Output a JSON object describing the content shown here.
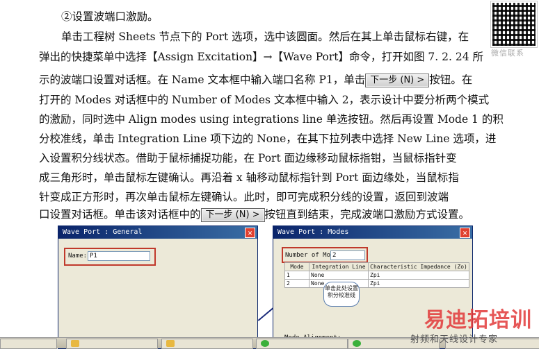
{
  "qr": {
    "label": "微信联系"
  },
  "lines": [
    "②设置波端口激励。",
    "单击工程树 Sheets 节点下的 Port 选项，选中该圆面。然后在其上单击鼠标右键，在",
    "弹出的快捷菜单中选择【Assign Excitation】→【Wave Port】命令，打开如图 7. 2. 24 所",
    "示的波端口设置对话框。在 Name 文本框中输入端口名称 P1，单击",
    "按钮。在",
    "打开的 Modes 对话框中的 Number of Modes 文本框中输入 2，表示设计中要分析两个模式",
    "的激励，同时选中 Align modes using integrations line 单选按钮。然后再设置 Mode 1 的积",
    "分校准线，单击 Integration Line 项下边的 None，在其下拉列表中选择 New Line 选项，进",
    "入设置积分线状态。借助于鼠标捕捉功能，在 Port 面边缘移动鼠标指钳，当鼠标指针变",
    "成三角形时，单击鼠标左键确认。再沿着 x 轴移动鼠标指针到 Port 面边缘处，当鼠标指",
    "针变成正方形时，再次单击鼠标左键确认。此时，即可完成积分线的设置，返回到波端",
    "口设置对话框。单击该对话框中的",
    "按钮直到结束，完成波端口激励方式设置。"
  ],
  "next_button": "下一步 (N) >",
  "dialog_general": {
    "title": "Wave Port : General",
    "name_label": "Name:",
    "name_value": "P1"
  },
  "dialog_modes": {
    "title": "Wave Port : Modes",
    "num_label": "Number of Modes:",
    "num_value": "2",
    "columns": [
      "Mode",
      "Integration Line",
      "Characteristic Impedance (Zo)"
    ],
    "rows": [
      [
        "1",
        "None",
        "Zpi"
      ],
      [
        "2",
        "None",
        "Zpi"
      ]
    ],
    "callout": "单击此处设置积分校准线",
    "alignment_label": "Mode Alignment:"
  },
  "watermark": {
    "main": "易迪拓培训",
    "sub": "射频和天线设计专家"
  }
}
